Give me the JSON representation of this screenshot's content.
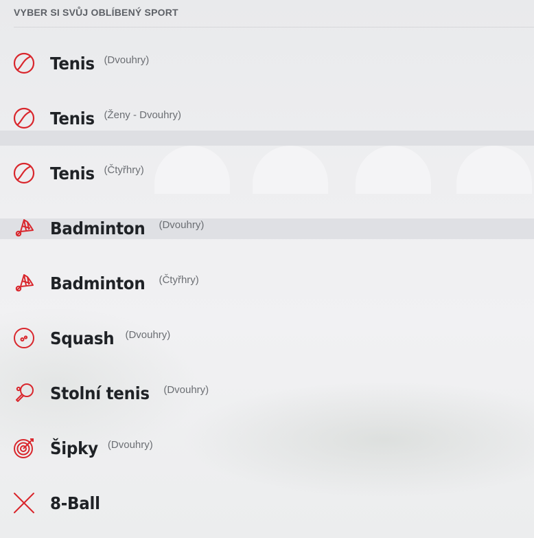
{
  "header": {
    "title": "VYBER SI SVŮJ OBLÍBENÝ SPORT"
  },
  "colors": {
    "accent": "#d9262c",
    "text": "#1f2226",
    "muted": "#6b6e73"
  },
  "sports": [
    {
      "name": "Tenis",
      "variant": "(Dvouhry)",
      "icon": "tennis-ball-icon"
    },
    {
      "name": "Tenis",
      "variant": "(Ženy - Dvouhry)",
      "icon": "tennis-ball-icon"
    },
    {
      "name": "Tenis",
      "variant": "(Čtyřhry)",
      "icon": "tennis-ball-icon"
    },
    {
      "name": "Badminton",
      "variant": "(Dvouhry)",
      "icon": "shuttlecock-icon"
    },
    {
      "name": "Badminton",
      "variant": "(Čtyřhry)",
      "icon": "shuttlecock-icon"
    },
    {
      "name": "Squash",
      "variant": "(Dvouhry)",
      "icon": "squash-ball-icon"
    },
    {
      "name": "Stolní tenis",
      "variant": "(Dvouhry)",
      "icon": "table-tennis-paddle-icon"
    },
    {
      "name": "Šipky",
      "variant": "(Dvouhry)",
      "icon": "dartboard-icon"
    },
    {
      "name": "8-Ball",
      "variant": "",
      "icon": "crossed-cues-icon"
    }
  ]
}
